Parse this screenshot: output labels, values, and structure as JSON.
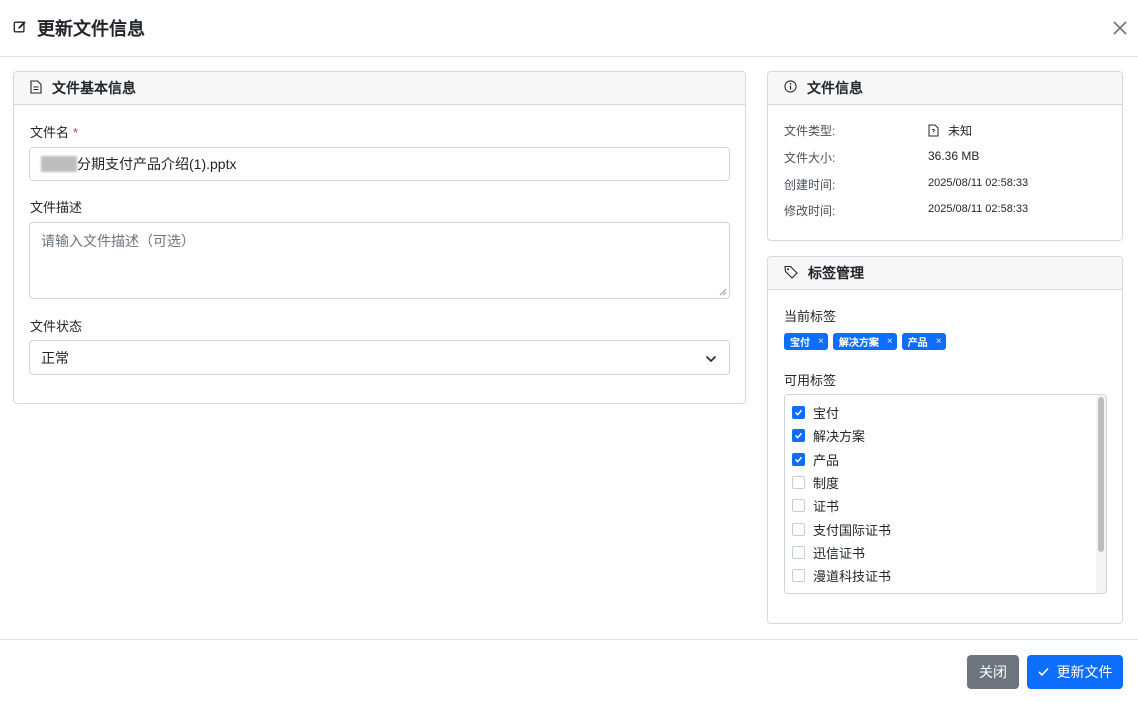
{
  "header": {
    "title": "更新文件信息"
  },
  "basic_card": {
    "title": "文件基本信息",
    "name_label": "文件名",
    "required_mark": "*",
    "name_value": "分期支付产品介绍(1).pptx",
    "desc_label": "文件描述",
    "desc_placeholder": "请输入文件描述（可选）",
    "status_label": "文件状态",
    "status_value": "正常"
  },
  "info_card": {
    "title": "文件信息",
    "rows": [
      {
        "label": "文件类型:",
        "value": "未知"
      },
      {
        "label": "文件大小:",
        "value": "36.36 MB"
      },
      {
        "label": "创建时间:",
        "value": "2025/08/11 02:58:33"
      },
      {
        "label": "修改时间:",
        "value": "2025/08/11 02:58:33"
      }
    ]
  },
  "tags_card": {
    "title": "标签管理",
    "current_label": "当前标签",
    "current_tags": [
      "宝付",
      "解决方案",
      "产品"
    ],
    "tag_remove": "×",
    "available_label": "可用标签",
    "available": [
      {
        "label": "宝付",
        "checked": true
      },
      {
        "label": "解决方案",
        "checked": true
      },
      {
        "label": "产品",
        "checked": true
      },
      {
        "label": "制度",
        "checked": false
      },
      {
        "label": "证书",
        "checked": false
      },
      {
        "label": "支付国际证书",
        "checked": false
      },
      {
        "label": "迅信证书",
        "checked": false
      },
      {
        "label": "漫道科技证书",
        "checked": false
      }
    ]
  },
  "footer": {
    "close_label": "关闭",
    "submit_label": "更新文件"
  },
  "colors": {
    "primary": "#0d6efd",
    "secondary": "#6c757d",
    "danger": "#dc3545"
  }
}
